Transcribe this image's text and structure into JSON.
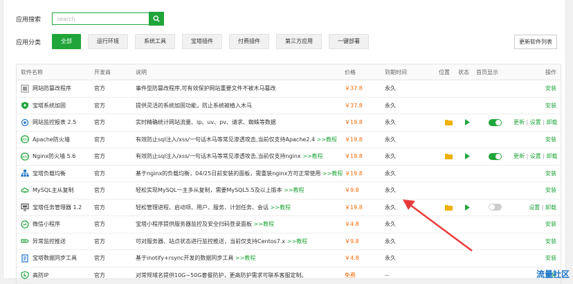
{
  "search": {
    "label": "应用搜索",
    "placeholder": "search",
    "value": ""
  },
  "category": {
    "label": "应用分类",
    "items": [
      {
        "label": "全部",
        "active": true
      },
      {
        "label": "运行环境"
      },
      {
        "label": "系统工具"
      },
      {
        "label": "宝塔插件"
      },
      {
        "label": "付费插件"
      },
      {
        "label": "第三方应用"
      },
      {
        "label": "一键部署"
      }
    ]
  },
  "update_button": "更新软件列表",
  "table": {
    "headers": {
      "name": "软件名称",
      "dev": "开发商",
      "desc": "说明",
      "price": "价格",
      "expire": "到期时间",
      "pos": "位置",
      "state": "状态",
      "home": "首页显示",
      "op": "操作"
    },
    "rows": [
      {
        "icon": "gears-icon",
        "name": "网站防篡改程序",
        "dev": "官方",
        "desc": "事件型防篡改程序,可有效保护网站重要文件不被木马篡改",
        "tutorial": "",
        "price": "￥37.8",
        "expire": "永久",
        "ops": [
          "安装"
        ],
        "color": "#999"
      },
      {
        "icon": "shield-plus-icon",
        "name": "宝塔系统加固",
        "dev": "官方",
        "desc": "提供灵活的系统加固功能，防止系统被植入木马",
        "tutorial": "",
        "price": "￥37.8",
        "expire": "永久",
        "ops": [
          "安装"
        ],
        "color": "#20a53a"
      },
      {
        "icon": "crosshair-icon",
        "name": "网站监控报表 2.5",
        "dev": "官方",
        "desc": "实时精确统计网站流量、ip、uv、pv、请求、蜘蛛等数据",
        "tutorial": "",
        "price": "￥19.8",
        "expire": "永久",
        "installed": true,
        "home": "on",
        "ops": [
          "更新",
          "设置",
          "卸载"
        ],
        "color": "#1a73c8"
      },
      {
        "icon": "waf-icon",
        "name": "Apache防火墙",
        "dev": "官方",
        "desc": "有效防止sql注入/xss/一句话木马等常见渗透攻击,当前仅支持Apache2.4",
        "tutorial": ">>教程",
        "price": "￥19.8",
        "expire": "永久",
        "ops": [
          "安装"
        ],
        "color": "#20a53a"
      },
      {
        "icon": "waf-icon",
        "name": "Nginx防火墙 5.6",
        "dev": "官方",
        "desc": "有效防止sql注入/xss/一句话木马等常见渗透攻击,当前仅支持nginx",
        "tutorial": ">>教程",
        "price": "￥19.8",
        "expire": "永久",
        "installed": true,
        "home": "on",
        "ops": [
          "更新",
          "设置",
          "卸载"
        ],
        "color": "#20a53a"
      },
      {
        "icon": "load-balance-icon",
        "name": "宝塔负载均衡",
        "dev": "官方",
        "desc": "基于nginx的负载均衡，04/25日前安装的面板，需重装nginx方可正常使用",
        "tutorial": ">>教程",
        "price": "￥19.8",
        "expire": "永久",
        "ops": [
          "安装"
        ],
        "color": "#1a73c8"
      },
      {
        "icon": "cloud-sync-icon",
        "name": "MySQL主从复制",
        "dev": "官方",
        "desc": "轻松实现MySQL一主多从复制，需要MySQL5.5及以上版本",
        "tutorial": ">>教程",
        "price": "￥9.8",
        "expire": "永久",
        "ops": [
          "安装"
        ],
        "color": "#20a53a"
      },
      {
        "icon": "monitor-icon",
        "name": "宝塔任务管理器 1.2",
        "dev": "官方",
        "desc": "轻松管理进程、启动项、用户、服务、计划任务、会话",
        "tutorial": ">>教程",
        "price": "￥19.8",
        "expire": "永久",
        "installed": true,
        "home": "off",
        "ops": [
          "设置",
          "卸载"
        ],
        "color": "#555"
      },
      {
        "icon": "mini-program-icon",
        "name": "微信小程序",
        "dev": "官方",
        "desc": "宝塔小程序提供服务器监控及安全扫码登录面板",
        "tutorial": ">>教程",
        "price": "￥4.8",
        "expire": "永久",
        "ops": [
          "安装"
        ],
        "color": "#20a53a"
      },
      {
        "icon": "alert-push-icon",
        "name": "异常监控推送",
        "dev": "官方",
        "desc": "可对服务器、站点状态进行监控推送，当前仅支持Centos7.x",
        "tutorial": ">>教程",
        "price": "￥9.8",
        "expire": "永久",
        "ops": [
          "安装"
        ],
        "color": "#20a53a"
      },
      {
        "icon": "file-sync-icon",
        "name": "宝塔数据同步工具",
        "dev": "官方",
        "desc": "基于inotify+rsync开发的数据同步工具",
        "tutorial": ">>教程",
        "price": "￥4.8",
        "expire": "永久",
        "ops": [
          "安装"
        ],
        "color": "#1a73c8"
      },
      {
        "icon": "ddos-shield-icon",
        "name": "高防IP",
        "dev": "官方",
        "desc": "对常规域名提供10G~50G套餐防护，更高防护需求可联系客服定制。",
        "tutorial": "",
        "price": "免费",
        "expire": "--",
        "ops": [
          "安装"
        ],
        "color": "#20a53a"
      }
    ]
  },
  "watermark": "流量社区"
}
